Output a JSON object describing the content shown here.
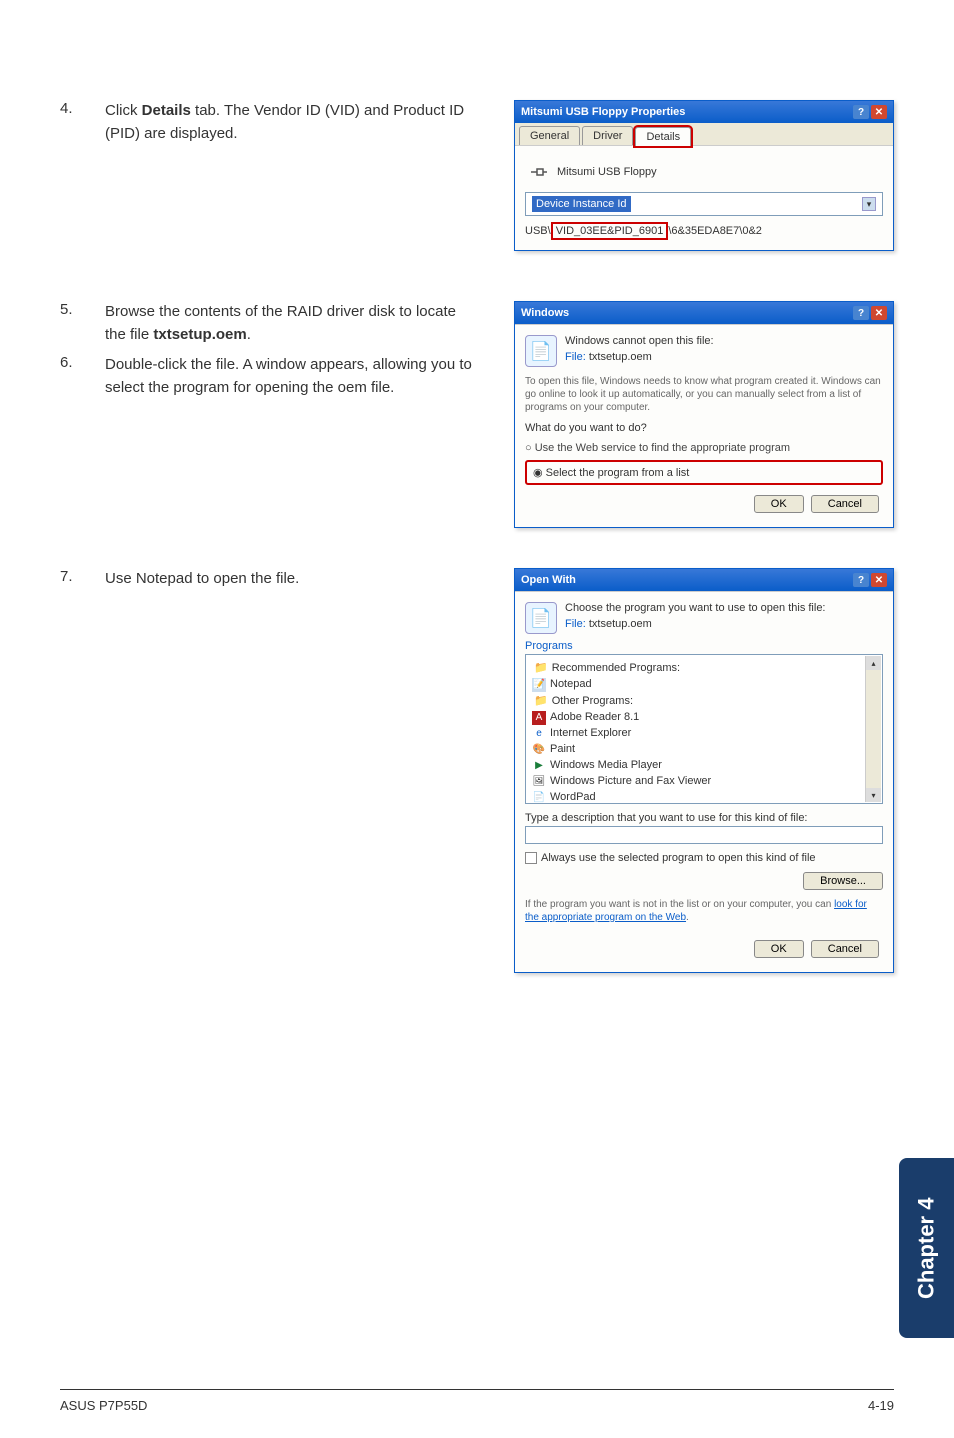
{
  "steps": {
    "s4": {
      "num": "4.",
      "text_before": "Click ",
      "bold": "Details",
      "text_after": " tab. The Vendor ID (VID) and Product ID (PID) are displayed."
    },
    "s5": {
      "num": "5.",
      "text_before": "Browse the contents of the RAID driver disk to locate the file ",
      "bold": "txtsetup.oem",
      "text_after": "."
    },
    "s6": {
      "num": "6.",
      "text": "Double-click the file. A window appears, allowing you to select the program for opening the oem file."
    },
    "s7": {
      "num": "7.",
      "text": "Use Notepad to open the file."
    }
  },
  "dialog1": {
    "title": "Mitsumi USB Floppy Properties",
    "tabs": {
      "t1": "General",
      "t2": "Driver",
      "t3": "Details"
    },
    "device_name": "Mitsumi USB Floppy",
    "field_label": "Device Instance Id",
    "value_prefix": "USB\\",
    "value_boxed": "VID_03EE&PID_6901",
    "value_suffix": "\\6&35EDA8E7\\0&2"
  },
  "dialog2": {
    "title": "Windows",
    "cannot_open": "Windows cannot open this file:",
    "file_label": "File:",
    "file_name": "txtsetup.oem",
    "info": "To open this file, Windows needs to know what program created it. Windows can go online to look it up automatically, or you can manually select from a list of programs on your computer.",
    "question": "What do you want to do?",
    "radio1": "Use the Web service to find the appropriate program",
    "radio2": "Select the program from a list",
    "ok": "OK",
    "cancel": "Cancel"
  },
  "dialog3": {
    "title": "Open With",
    "choose": "Choose the program you want to use to open this file:",
    "file_label": "File:",
    "file_name": "txtsetup.oem",
    "programs_label": "Programs",
    "rec_label": "Recommended Programs:",
    "notepad": "Notepad",
    "other_label": "Other Programs:",
    "adobe": "Adobe Reader 8.1",
    "ie": "Internet Explorer",
    "paint": "Paint",
    "wmp": "Windows Media Player",
    "wpfv": "Windows Picture and Fax Viewer",
    "wordpad": "WordPad",
    "type_desc": "Type a description that you want to use for this kind of file:",
    "always": "Always use the selected program to open this kind of file",
    "browse": "Browse...",
    "not_in_list_1": "If the program you want is not in the list or on your computer, you can ",
    "look": "look for the appropriate program on the Web",
    "not_in_list_2": ".",
    "ok": "OK",
    "cancel": "Cancel"
  },
  "chapter": "Chapter 4",
  "footer": {
    "left": "ASUS P7P55D",
    "right": "4-19"
  }
}
